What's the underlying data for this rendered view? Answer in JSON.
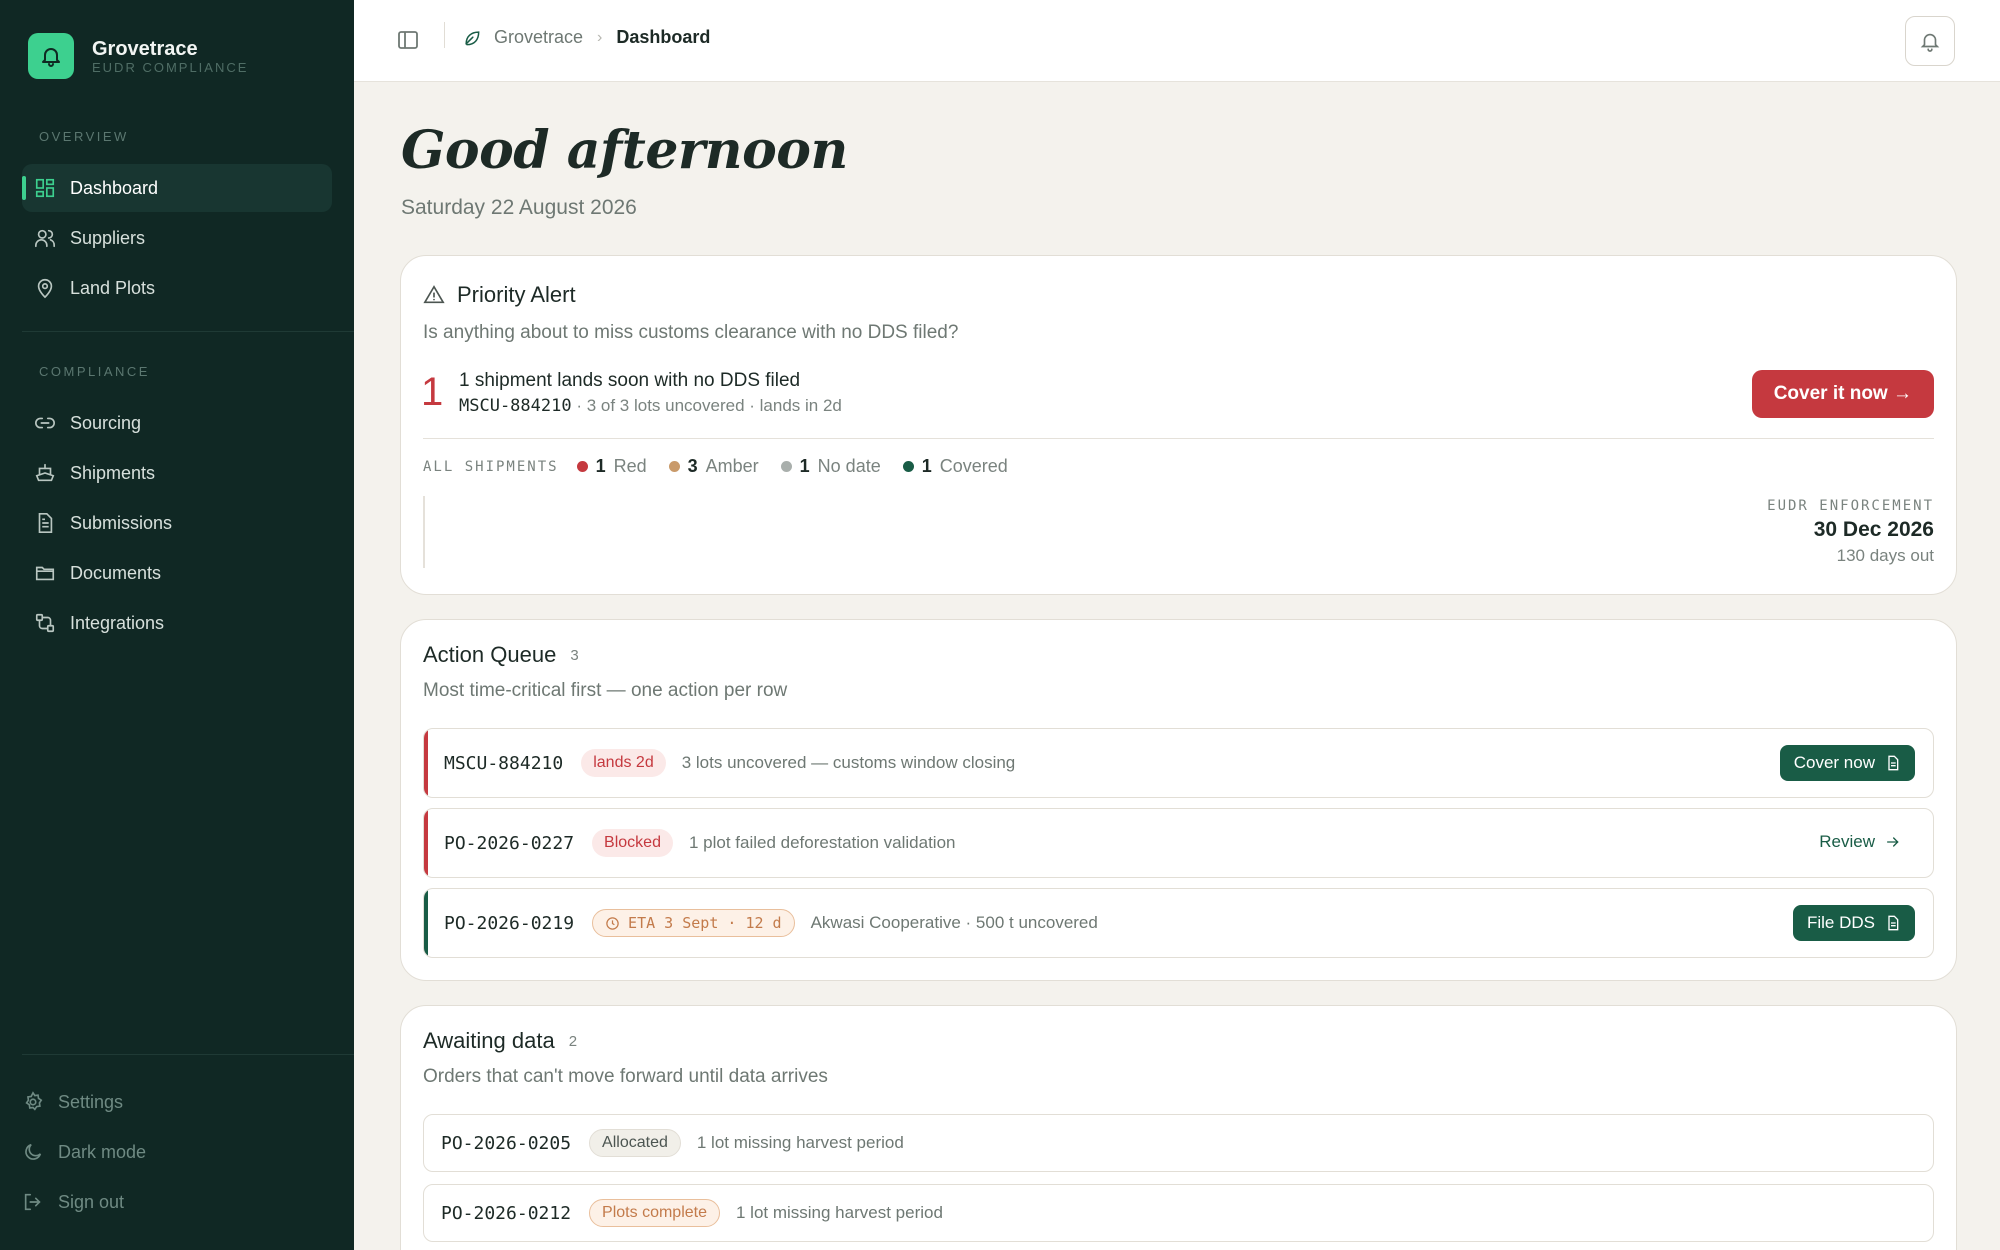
{
  "brand": {
    "name": "Grovetrace",
    "subtitle": "EUDR COMPLIANCE"
  },
  "sidebar": {
    "sections": [
      {
        "label": "OVERVIEW",
        "items": [
          {
            "label": "Dashboard",
            "icon": "grid-icon",
            "active": true
          },
          {
            "label": "Suppliers",
            "icon": "users-icon"
          },
          {
            "label": "Land Plots",
            "icon": "map-pin-icon"
          }
        ]
      },
      {
        "label": "COMPLIANCE",
        "items": [
          {
            "label": "Sourcing",
            "icon": "link-icon"
          },
          {
            "label": "Shipments",
            "icon": "ship-icon"
          },
          {
            "label": "Submissions",
            "icon": "document-icon"
          },
          {
            "label": "Documents",
            "icon": "folder-icon"
          },
          {
            "label": "Integrations",
            "icon": "integrations-icon"
          }
        ]
      }
    ],
    "bottom": [
      {
        "label": "Settings",
        "icon": "gear-icon"
      },
      {
        "label": "Dark mode",
        "icon": "moon-icon"
      },
      {
        "label": "Sign out",
        "icon": "sign-out-icon"
      }
    ]
  },
  "breadcrumb": {
    "root": "Grovetrace",
    "current": "Dashboard"
  },
  "greeting": "Good afternoon",
  "date": "Saturday 22 August 2026",
  "priority_alert": {
    "title": "Priority Alert",
    "question": "Is anything about to miss customs clearance with no DDS filed?",
    "count": "1",
    "headline": "1 shipment lands soon with no DDS filed",
    "container_id": "MSCU-884210",
    "detail": "· 3 of 3 lots uncovered · lands in 2d",
    "cta": "Cover it now →",
    "shipments_label": "ALL SHIPMENTS",
    "statuses": [
      {
        "count": "1",
        "label": "Red",
        "color": "#c5393f"
      },
      {
        "count": "3",
        "label": "Amber",
        "color": "#c99a6a"
      },
      {
        "count": "1",
        "label": "No date",
        "color": "#a9afac"
      },
      {
        "count": "1",
        "label": "Covered",
        "color": "#195c46"
      }
    ],
    "enforcement": {
      "label": "EUDR ENFORCEMENT",
      "date": "30 Dec 2026",
      "remaining": "130 days out"
    }
  },
  "action_queue": {
    "title": "Action Queue",
    "count": "3",
    "subtitle": "Most time-critical first — one action per row",
    "rows": [
      {
        "id": "MSCU-884210",
        "badge": "lands 2d",
        "desc": "3 lots uncovered — customs window closing",
        "action": "Cover now",
        "accent": "#c5393f"
      },
      {
        "id": "PO-2026-0227",
        "badge": "Blocked",
        "desc": "1 plot failed deforestation validation",
        "action": "Review",
        "accent": "#c5393f"
      },
      {
        "id": "PO-2026-0219",
        "badge": "ETA 3 Sept · 12 d",
        "desc": "Akwasi Cooperative · 500 t uncovered",
        "action": "File DDS",
        "accent": "#195c46"
      }
    ]
  },
  "awaiting": {
    "title": "Awaiting data",
    "count": "2",
    "subtitle": "Orders that can't move forward until data arrives",
    "rows": [
      {
        "id": "PO-2026-0205",
        "badge": "Allocated",
        "desc": "1 lot missing harvest period"
      },
      {
        "id": "PO-2026-0212",
        "badge": "Plots complete",
        "desc": "1 lot missing harvest period"
      }
    ]
  }
}
